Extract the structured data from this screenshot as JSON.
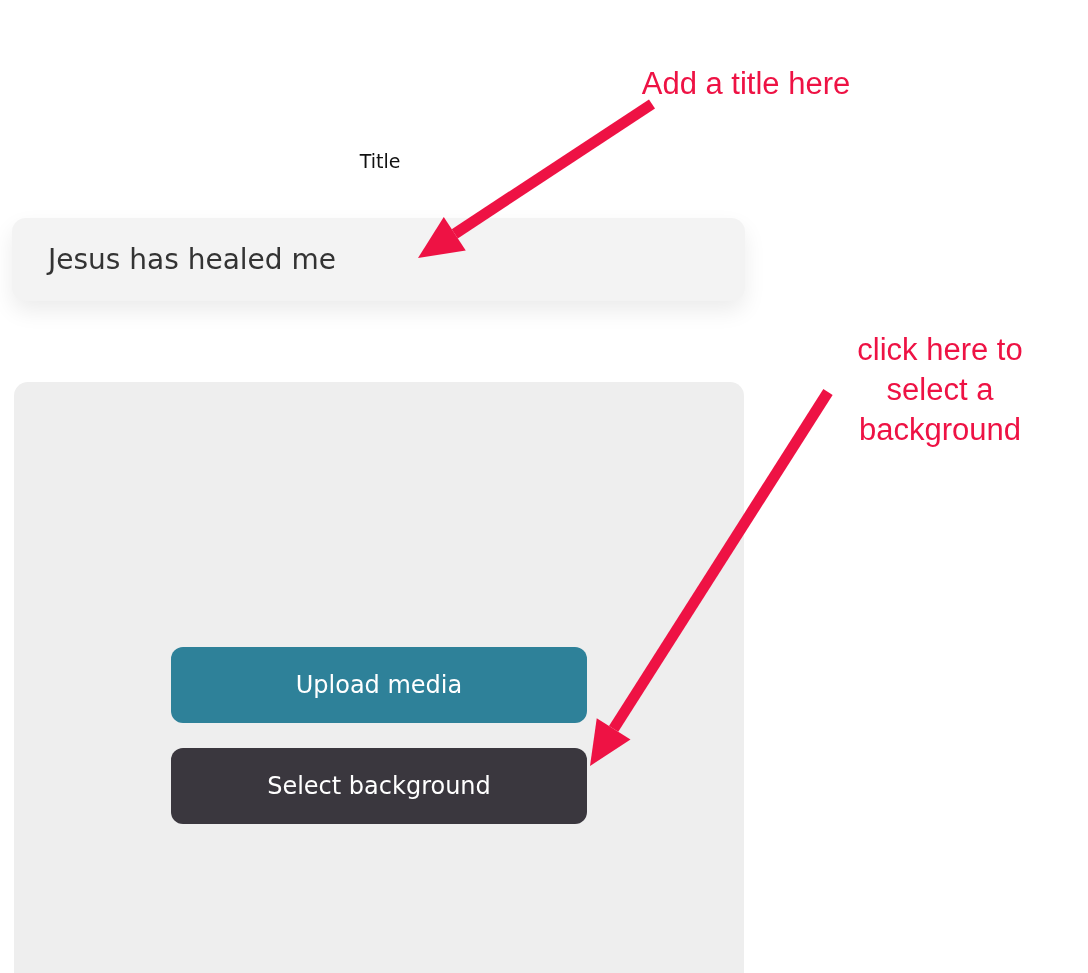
{
  "form": {
    "title_label": "Title",
    "title_field": {
      "value": "Jesus has healed me"
    }
  },
  "buttons": [
    {
      "label": "Upload media",
      "kind": "primary"
    },
    {
      "label": "Select background",
      "kind": "dark"
    }
  ],
  "annotations": [
    {
      "lines": [
        "Add a title here"
      ]
    },
    {
      "lines": [
        "click here to",
        "select a",
        "background"
      ]
    }
  ]
}
